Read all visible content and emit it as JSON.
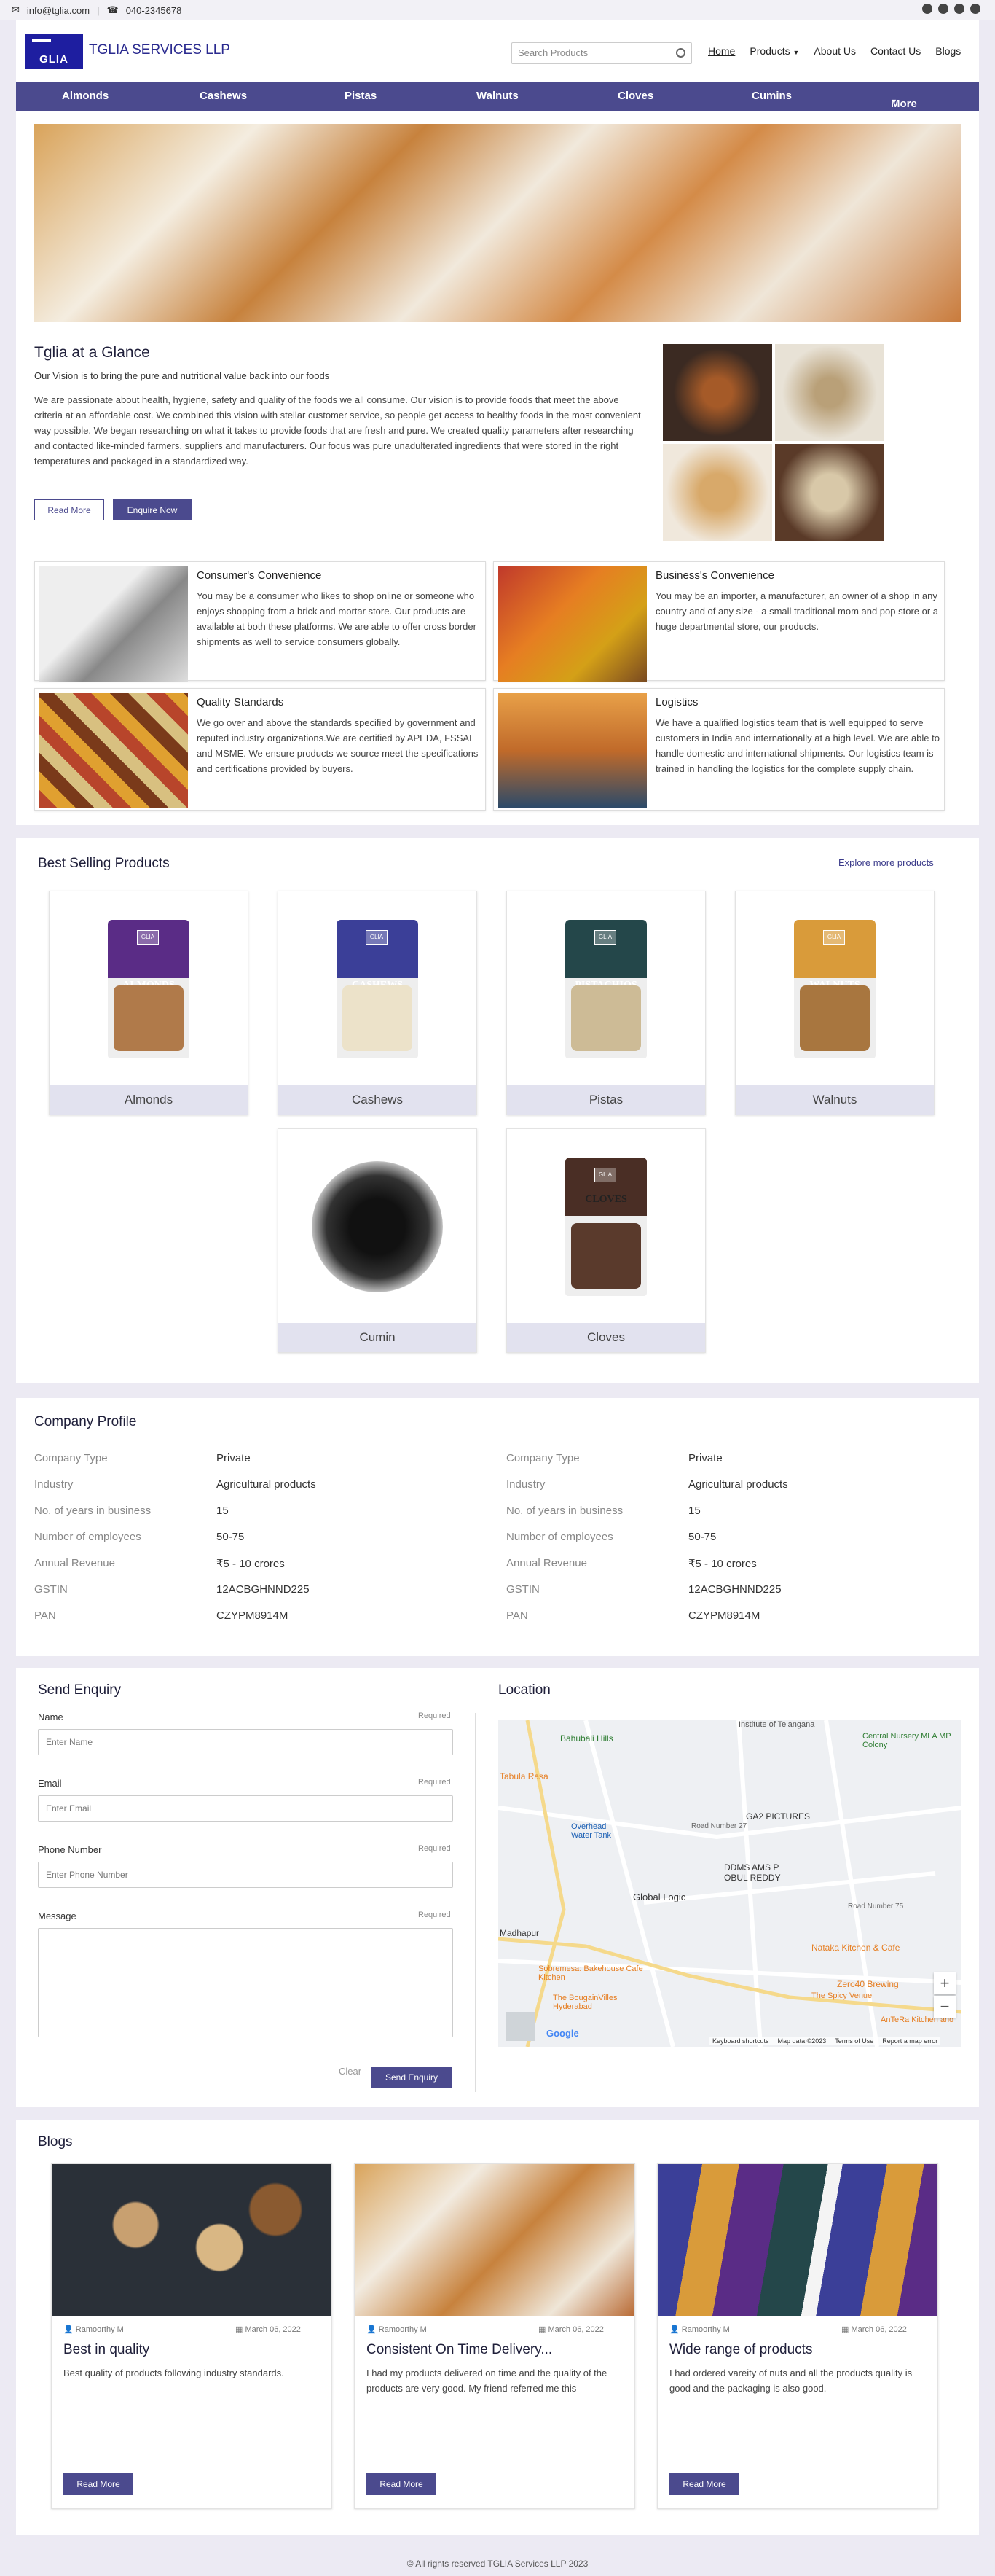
{
  "topbar": {
    "email": "info@tglia.com",
    "phone": "040-2345678",
    "social_icons": [
      "twitter-icon",
      "facebook-icon",
      "github-icon",
      "instagram-icon"
    ]
  },
  "header": {
    "logo_text": "GLIA",
    "brand": "TGLIA SERVICES LLP",
    "search_placeholder": "Search Products",
    "nav": [
      "Home",
      "Products",
      "About Us",
      "Contact Us",
      "Blogs"
    ]
  },
  "categories": [
    "Almonds",
    "Cashews",
    "Pistas",
    "Walnuts",
    "Cloves",
    "Cumins",
    "More"
  ],
  "glance": {
    "title": "Tglia at a Glance",
    "vision": "Our Vision is to bring the pure and nutritional value back into our foods",
    "paragraph": "We are passionate about health, hygiene, safety and quality of the foods we all consume. Our vision is to provide foods that meet the above criteria at an affordable cost. We combined this vision with stellar customer service, so people get access to healthy foods in the most convenient way possible. We began researching on what it takes to provide foods that are fresh and pure. We created quality parameters after researching and contacted like-minded farmers, suppliers and manufacturers. Our focus was pure unadulterated ingredients that were stored in the right temperatures and packaged in a standardized way.",
    "read_more": "Read More",
    "enquire": "Enquire Now"
  },
  "features": [
    {
      "title": "Consumer's Convenience",
      "text": "You may be a consumer who likes to shop online or someone who enjoys shopping from a brick and mortar store. Our products are available at both these platforms. We are able to offer cross border shipments as well to service consumers globally."
    },
    {
      "title": "Business's Convenience",
      "text": "You may be an importer, a manufacturer, an owner of a shop in any country and of any size - a small traditional mom and pop store or a huge departmental store, our products."
    },
    {
      "title": "Quality Standards",
      "text": "We go over and above the standards specified by government and reputed industry organizations.We are certified by APEDA, FSSAI and MSME. We ensure products we source meet the specifications and certifications provided by buyers."
    },
    {
      "title": "Logistics",
      "text": "We have a qualified logistics team that is well equipped to serve customers in India and internationally at a high level. We are able to handle domestic and international shipments. Our logistics team is trained in handling the logistics for the complete supply chain."
    }
  ],
  "best_selling": {
    "title": "Best Selling Products",
    "explore": "Explore more products",
    "products": [
      {
        "name": "Almonds",
        "pack_label": "ALMONDS",
        "color": "#5a2c86",
        "nut": "#b07a4a"
      },
      {
        "name": "Cashews",
        "pack_label": "CASHEWS",
        "color": "#3b3f98",
        "nut": "#ece2c9"
      },
      {
        "name": "Pistas",
        "pack_label": "PISTACHIOS",
        "color": "#24474a",
        "nut": "#cdbb96"
      },
      {
        "name": "Walnuts",
        "pack_label": "WALNUTS",
        "color": "#d99b3a",
        "nut": "#a8763f"
      },
      {
        "name": "Cumin",
        "pack_label": "",
        "color": "#2b2b2b",
        "nut": "#2b2b2b"
      },
      {
        "name": "Cloves",
        "pack_label": "CLOVES",
        "color": "#4a2e25",
        "nut": "#5a3a2c"
      }
    ],
    "pack_brand": "GLIA"
  },
  "company_profile": {
    "title": "Company Profile",
    "rows": [
      {
        "label": "Company Type",
        "value": "Private"
      },
      {
        "label": "Industry",
        "value": "Agricultural products"
      },
      {
        "label": "No. of years in business",
        "value": "15"
      },
      {
        "label": "Number of employees",
        "value": "50-75"
      },
      {
        "label": "Annual Revenue",
        "value": "₹5 - 10 crores"
      },
      {
        "label": "GSTIN",
        "value": "12ACBGHNND225"
      },
      {
        "label": "PAN",
        "value": "CZYPM8914M"
      }
    ]
  },
  "enquiry": {
    "title": "Send Enquiry",
    "required": "Required",
    "fields": [
      {
        "label": "Name",
        "placeholder": "Enter Name"
      },
      {
        "label": "Email",
        "placeholder": "Enter Email"
      },
      {
        "label": "Phone Number",
        "placeholder": "Enter Phone Number"
      },
      {
        "label": "Message",
        "placeholder": ""
      }
    ],
    "clear": "Clear",
    "send": "Send Enquiry"
  },
  "location": {
    "title": "Location",
    "places": [
      "Bahubali Hills",
      "Institute of Telangana",
      "Central Nursery MLA MP Colony",
      "Tabula Rasa",
      "GA2 PICTURES",
      "Overhead Water Tank",
      "Road Number 27",
      "DDMS AMS P OBUL REDDY",
      "Global Logic",
      "Road Number 75",
      "Madhapur",
      "Sobremesa: Bakehouse Cafe Kitchen",
      "Nataka Kitchen & Cafe",
      "Zero40 Brewing",
      "The Spicy Venue",
      "The BougainVilles Hyderabad",
      "AnTeRa Kitchen and"
    ],
    "attribution": [
      "Google",
      "Keyboard shortcuts",
      "Map data ©2023",
      "Terms of Use",
      "Report a map error"
    ],
    "zoom_in": "+",
    "zoom_out": "−"
  },
  "blogs": {
    "title": "Blogs",
    "read_more": "Read More",
    "posts": [
      {
        "author": "Ramoorthy M",
        "date": "March 06, 2022",
        "title": "Best in quality",
        "text": "Best quality of products following industry standards."
      },
      {
        "author": "Ramoorthy M",
        "date": "March 06, 2022",
        "title": "Consistent On Time Delivery...",
        "text": "I had my products delivered on time and the quality of the products are very good. My friend referred me this"
      },
      {
        "author": "Ramoorthy M",
        "date": "March 06, 2022",
        "title": "Wide range of products",
        "text": "I had ordered vareity of nuts and all the products quality is good and the packaging is also good."
      }
    ]
  },
  "footer": "© All rights reserved TGLIA Services LLP 2023"
}
